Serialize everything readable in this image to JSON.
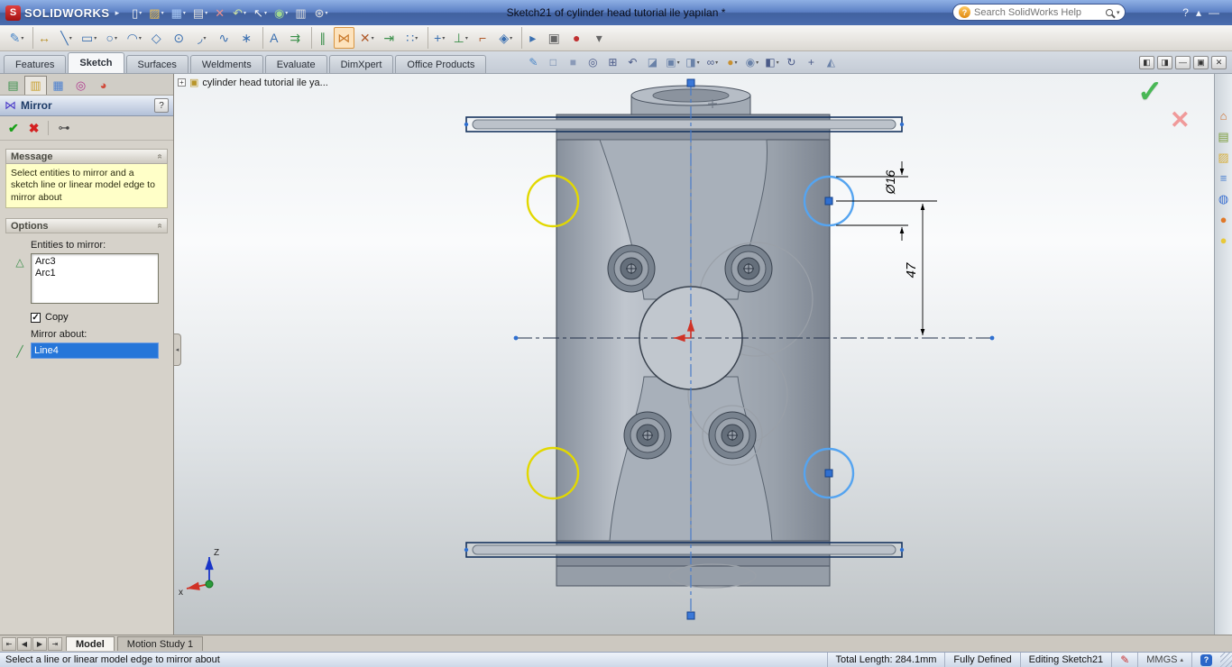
{
  "colors": {
    "titlebar_blue": "#4a6cae",
    "selection_blue": "#2676d9",
    "sketch_selected_blue": "#55a4f0",
    "sketch_preview_yellow": "#e2d800",
    "message_yellow": "#ffffc8",
    "origin_red": "#d03226",
    "ok_green": "#49b856"
  },
  "titlebar": {
    "logo_glyph": "S",
    "logo_text": "SOLIDWORKS",
    "menu_expand_glyph": "▸",
    "document_title": "Sketch21 of cylinder head tutorial ile yapılan *",
    "search_placeholder": "Search SolidWorks Help",
    "search_help_glyph": "?",
    "search_caret": "▾",
    "icons": [
      {
        "name": "new-document-icon",
        "glyph": "▯",
        "color": "#f2f2f2",
        "caret": "▾"
      },
      {
        "name": "open-icon",
        "glyph": "▨",
        "color": "#f0c050",
        "caret": "▾"
      },
      {
        "name": "save-icon",
        "glyph": "▦",
        "color": "#a9c9f5",
        "caret": "▾"
      },
      {
        "name": "print-icon",
        "glyph": "▤",
        "color": "#e0e0e0",
        "caret": "▾"
      },
      {
        "name": "delete-icon",
        "glyph": "✕",
        "color": "#e89090"
      },
      {
        "name": "undo-icon",
        "glyph": "↶",
        "color": "#cfe3a0",
        "caret": "▾"
      },
      {
        "name": "select-icon",
        "glyph": "↖",
        "color": "#f5f5f5",
        "caret": "▾"
      },
      {
        "name": "rebuild-icon",
        "glyph": "◉",
        "color": "#9fd88f",
        "caret": "▾"
      },
      {
        "name": "file-properties-icon",
        "glyph": "▥",
        "color": "#e0e0e0"
      },
      {
        "name": "options-icon",
        "glyph": "⊛",
        "color": "#e0e0e0",
        "caret": "▾"
      }
    ],
    "window_icons": [
      {
        "name": "titlebar-help-icon",
        "glyph": "?"
      },
      {
        "name": "titlebar-expand-icon",
        "glyph": "▴"
      },
      {
        "name": "titlebar-minimize-icon",
        "glyph": "—"
      }
    ]
  },
  "sketch_toolbar": {
    "icons": [
      {
        "name": "exit-sketch-icon",
        "glyph": "✎",
        "color": "#4a86c8",
        "caret": "▾"
      },
      {
        "name": "smart-dimension-icon",
        "glyph": "↔",
        "color": "#b8902a",
        "sep": "sep"
      },
      {
        "name": "line-icon",
        "glyph": "╲",
        "color": "#3a6fb0",
        "caret": "▾"
      },
      {
        "name": "rectangle-icon",
        "glyph": "▭",
        "color": "#3a6fb0",
        "caret": "▾"
      },
      {
        "name": "circle-icon",
        "glyph": "○",
        "color": "#3a6fb0",
        "caret": "▾"
      },
      {
        "name": "arc-icon",
        "glyph": "◠",
        "color": "#3a6fb0",
        "caret": "▾"
      },
      {
        "name": "polygon-icon",
        "glyph": "◇",
        "color": "#3a6fb0"
      },
      {
        "name": "ellipse-icon",
        "glyph": "⊙",
        "color": "#3a6fb0"
      },
      {
        "name": "fillet-icon",
        "glyph": "◞",
        "color": "#3a6fb0",
        "caret": "▾"
      },
      {
        "name": "spline-icon",
        "glyph": "∿",
        "color": "#3a6fb0"
      },
      {
        "name": "point-icon",
        "glyph": "∗",
        "color": "#3a6fb0"
      },
      {
        "name": "text-icon",
        "glyph": "A",
        "color": "#3a6fb0",
        "sep": "sep"
      },
      {
        "name": "convert-entities-icon",
        "glyph": "⇉",
        "color": "#3a8f4a"
      },
      {
        "name": "offset-entities-icon",
        "glyph": "∥",
        "color": "#3a8f4a",
        "sep": "sep"
      },
      {
        "name": "mirror-entities-icon",
        "glyph": "⋈",
        "color": "#c87828",
        "state": "active"
      },
      {
        "name": "trim-entities-icon",
        "glyph": "✕",
        "color": "#b05a2a",
        "caret": "▾"
      },
      {
        "name": "extend-entities-icon",
        "glyph": "⇥",
        "color": "#3a8f4a"
      },
      {
        "name": "linear-pattern-icon",
        "glyph": "∷",
        "color": "#3a6fb0",
        "caret": "▾"
      },
      {
        "name": "move-entities-icon",
        "glyph": "+",
        "color": "#3a6fb0",
        "caret": "▾",
        "sep": "sep"
      },
      {
        "name": "display-relations-icon",
        "glyph": "⊥",
        "color": "#3a8f4a",
        "caret": "▾"
      },
      {
        "name": "repair-sketch-icon",
        "glyph": "⌐",
        "color": "#b05a2a"
      },
      {
        "name": "quick-snaps-icon",
        "glyph": "◈",
        "color": "#3a6fb0",
        "caret": "▾"
      },
      {
        "name": "rapid-sketch-icon",
        "glyph": "▸",
        "color": "#3a6fb0",
        "sep": "sep"
      },
      {
        "name": "screen-capture-icon",
        "glyph": "▣",
        "color": "#666666"
      },
      {
        "name": "record-video-icon",
        "glyph": "●",
        "color": "#c03030"
      },
      {
        "name": "more-options-icon",
        "glyph": "▾",
        "color": "#666666"
      }
    ]
  },
  "command_manager": {
    "tabs": [
      {
        "name": "tab-features",
        "label": "Features"
      },
      {
        "name": "tab-sketch",
        "label": "Sketch",
        "state": "active"
      },
      {
        "name": "tab-surfaces",
        "label": "Surfaces"
      },
      {
        "name": "tab-weldments",
        "label": "Weldments"
      },
      {
        "name": "tab-evaluate",
        "label": "Evaluate"
      },
      {
        "name": "tab-dimxpert",
        "label": "DimXpert"
      },
      {
        "name": "tab-office-products",
        "label": "Office Products"
      }
    ],
    "headsup_icons": [
      {
        "name": "sketch-snap-icon",
        "glyph": "✎",
        "color": "#4a86c8"
      },
      {
        "name": "wireframe-cube-icon",
        "glyph": "□",
        "color": "#6a82a8"
      },
      {
        "name": "shaded-cube-icon",
        "glyph": "■",
        "color": "#8a9ab8"
      },
      {
        "name": "zoom-fit-icon",
        "glyph": "◎",
        "color": "#4a5a88"
      },
      {
        "name": "zoom-area-icon",
        "glyph": "⊞",
        "color": "#4a5a88"
      },
      {
        "name": "previous-view-icon",
        "glyph": "↶",
        "color": "#4a5a88"
      },
      {
        "name": "section-view-icon",
        "glyph": "◪",
        "color": "#6a82a8"
      },
      {
        "name": "view-orientation-icon",
        "glyph": "▣",
        "color": "#6a82a8",
        "caret": "▾"
      },
      {
        "name": "display-style-icon",
        "glyph": "◨",
        "color": "#6a82a8",
        "caret": "▾"
      },
      {
        "name": "hide-show-items-icon",
        "glyph": "∞",
        "color": "#4a5a88",
        "caret": "▾"
      },
      {
        "name": "edit-appearance-icon",
        "glyph": "●",
        "color": "#c89030",
        "caret": "▾"
      },
      {
        "name": "apply-scene-icon",
        "glyph": "◉",
        "color": "#6a82a8",
        "caret": "▾"
      },
      {
        "name": "view-settings-icon",
        "glyph": "◧",
        "color": "#4a5a88",
        "caret": "▾"
      },
      {
        "name": "rotate-view-icon",
        "glyph": "↻",
        "color": "#4a5a88"
      },
      {
        "name": "pan-icon",
        "glyph": "+",
        "color": "#4a5a88"
      },
      {
        "name": "3d-drawing-view-icon",
        "glyph": "◭",
        "color": "#6a82a8"
      }
    ],
    "window_buttons": [
      {
        "name": "dock-left-icon",
        "glyph": "◧"
      },
      {
        "name": "dock-right-icon",
        "glyph": "◨"
      },
      {
        "name": "minimize-document-icon",
        "glyph": "—"
      },
      {
        "name": "restore-document-icon",
        "glyph": "▣"
      },
      {
        "name": "close-document-icon",
        "glyph": "✕"
      }
    ]
  },
  "feature_tree": {
    "expand_glyph": "+",
    "part_icon_glyph": "▣",
    "part_label": "cylinder head tutorial ile ya..."
  },
  "property_manager": {
    "panel_tabs": [
      {
        "name": "featuremanager-tab-icon",
        "glyph": "▤",
        "color": "#3a8f4a"
      },
      {
        "name": "propertymanager-tab-icon",
        "glyph": "▥",
        "color": "#c8a030",
        "state": "active"
      },
      {
        "name": "configurationmanager-tab-icon",
        "glyph": "▦",
        "color": "#4a7fd0"
      },
      {
        "name": "dimxpertmanager-tab-icon",
        "glyph": "◎",
        "color": "#b03a8f"
      },
      {
        "name": "displaymanager-tab-icon",
        "glyph": "◕",
        "color": "#d04a3a"
      }
    ],
    "icon_glyph": "⋈",
    "title": "Mirror",
    "help_glyph": "?",
    "ok_glyph": "✔",
    "cancel_glyph": "✖",
    "pin_glyph": "⊶",
    "collapse_glyph": "»",
    "message": {
      "header": "Message",
      "text": "Select entities to mirror and a sketch line or linear model edge to mirror about"
    },
    "options": {
      "header": "Options",
      "entities_label": "Entities to mirror:",
      "entities_icon_glyph": "△",
      "entities": [
        "Arc3",
        "Arc1"
      ],
      "copy_checked_glyph": "✓",
      "copy_label": "Copy",
      "mirror_about_label": "Mirror about:",
      "mirror_about_icon_glyph": "╱",
      "mirror_about_value": "Line4"
    }
  },
  "viewport": {
    "dimensions": {
      "diameter_label": "Ø16",
      "length_label": "47"
    },
    "triad": {
      "z_label": "Z",
      "x_label": "x"
    },
    "confirm": {
      "ok_glyph": "✓",
      "cancel_glyph": "✕"
    },
    "collapse_handle_glyph": "◂"
  },
  "task_pane": {
    "icons": [
      {
        "name": "task-pane-home-icon",
        "glyph": "⌂",
        "color": "#d07030"
      },
      {
        "name": "design-library-icon",
        "glyph": "▤",
        "color": "#7a9c3a"
      },
      {
        "name": "file-explorer-icon",
        "glyph": "▨",
        "color": "#d8b040"
      },
      {
        "name": "toolbox-icon",
        "glyph": "≡",
        "color": "#4a7fd0"
      },
      {
        "name": "online-resources-icon",
        "glyph": "◍",
        "color": "#3a6fd0"
      },
      {
        "name": "appearances-icon",
        "glyph": "●",
        "color": "#e07828"
      },
      {
        "name": "decals-icon",
        "glyph": "●",
        "color": "#e8c838"
      }
    ]
  },
  "sheet_tabs": {
    "nav_icons": [
      {
        "name": "first-sheet-icon",
        "glyph": "⇤"
      },
      {
        "name": "prev-sheet-icon",
        "glyph": "◀"
      },
      {
        "name": "next-sheet-icon",
        "glyph": "▶"
      },
      {
        "name": "last-sheet-icon",
        "glyph": "⇥"
      }
    ],
    "tabs": [
      {
        "name": "tab-model",
        "label": "Model",
        "state": "active"
      },
      {
        "name": "tab-motion-study",
        "label": "Motion Study 1"
      }
    ]
  },
  "status_bar": {
    "message": "Select a line or linear model edge to mirror about",
    "total_length": "Total Length: 284.1mm",
    "constraint_status": "Fully Defined",
    "editing_status": "Editing Sketch21",
    "sketch_icon_glyph": "✎",
    "units": "MMGS",
    "units_caret": "▴",
    "help_icon_glyph": "?"
  }
}
